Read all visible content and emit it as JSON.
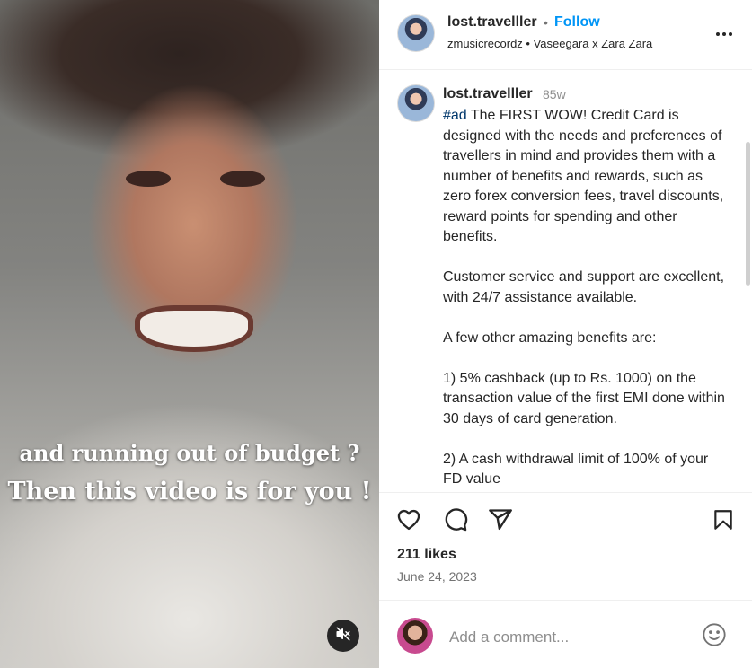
{
  "media": {
    "caption_line1": "and running out of budget ?",
    "caption_line2": "Then this video is for you !",
    "mute_icon": "speaker-muted-icon"
  },
  "header": {
    "username": "lost.travelller",
    "separator": "•",
    "follow_label": "Follow",
    "audio": "zmusicrecordz • Vaseegara x Zara Zara",
    "more_icon": "more-horizontal-icon"
  },
  "caption": {
    "username": "lost.travelller",
    "time": "85w",
    "hashtag": "#ad",
    "text": " The FIRST WOW! Credit Card is designed with the needs and preferences of travellers in mind and provides them with a number of benefits and rewards, such as zero forex conversion fees, travel discounts, reward points for spending and other benefits.\n\nCustomer service and support are excellent, with 24/7 assistance available.\n\nA few other amazing benefits are:\n\n1) 5% cashback (up to Rs. 1000) on the transaction value of the first EMI done within 30 days of card generation.\n\n2) A cash withdrawal limit of 100% of your FD value"
  },
  "actions": {
    "like_icon": "heart-icon",
    "comment_icon": "comment-icon",
    "share_icon": "share-icon",
    "save_icon": "bookmark-icon"
  },
  "stats": {
    "likes": "211 likes",
    "date": "June 24, 2023"
  },
  "comment": {
    "placeholder": "Add a comment...",
    "emoji_icon": "emoji-icon"
  },
  "colors": {
    "follow": "#0095f6",
    "hashtag": "#00376b",
    "text": "#262626",
    "muted": "#737373"
  }
}
